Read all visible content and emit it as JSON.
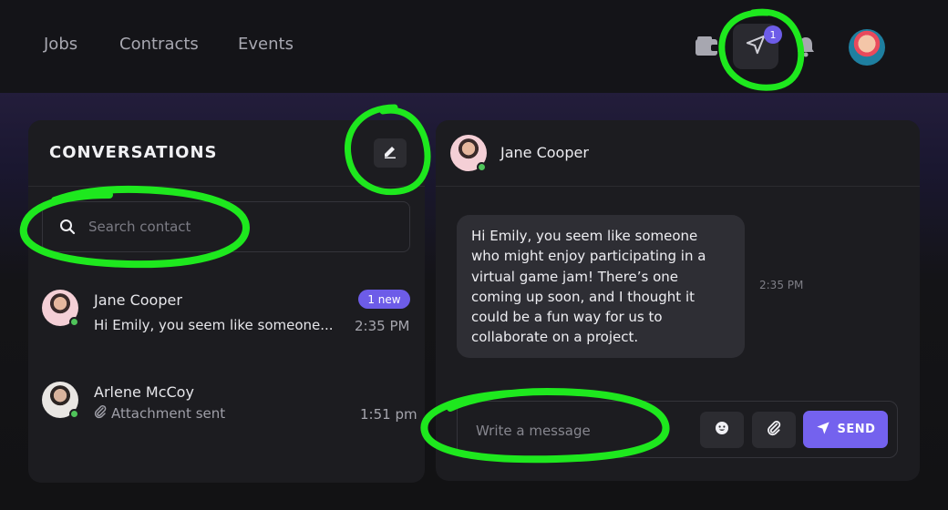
{
  "nav": {
    "links": [
      "Jobs",
      "Contracts",
      "Events"
    ],
    "notification_count": "1"
  },
  "conversations": {
    "title": "CONVERSATIONS",
    "search_placeholder": "Search contact",
    "contacts": [
      {
        "name": "Jane Cooper",
        "preview": "Hi Emily, you seem like someone...",
        "time": "2:35 PM",
        "badge": "1 new",
        "online": true
      },
      {
        "name": "Arlene McCoy",
        "preview": "Attachment sent",
        "time": "1:51 pm",
        "online": true
      }
    ]
  },
  "chat": {
    "contact_name": "Jane Cooper",
    "message_lines": [
      "Hi Emily, you seem like someone",
      "who might enjoy participating in a",
      "virtual game jam! There’s one",
      "coming up soon, and I thought it",
      "could be a fun way for us to",
      "collaborate on a project."
    ],
    "message_time": "2:35 PM",
    "composer_placeholder": "Write a message",
    "send_label": "SEND"
  },
  "colors": {
    "accent": "#7462ee",
    "annotation": "#1ee81e",
    "online": "#4fc45a"
  },
  "icons": [
    "wallet-icon",
    "send-nav-icon",
    "bell-icon",
    "search-icon",
    "compose-icon",
    "emoji-icon",
    "paperclip-icon",
    "send-icon"
  ]
}
